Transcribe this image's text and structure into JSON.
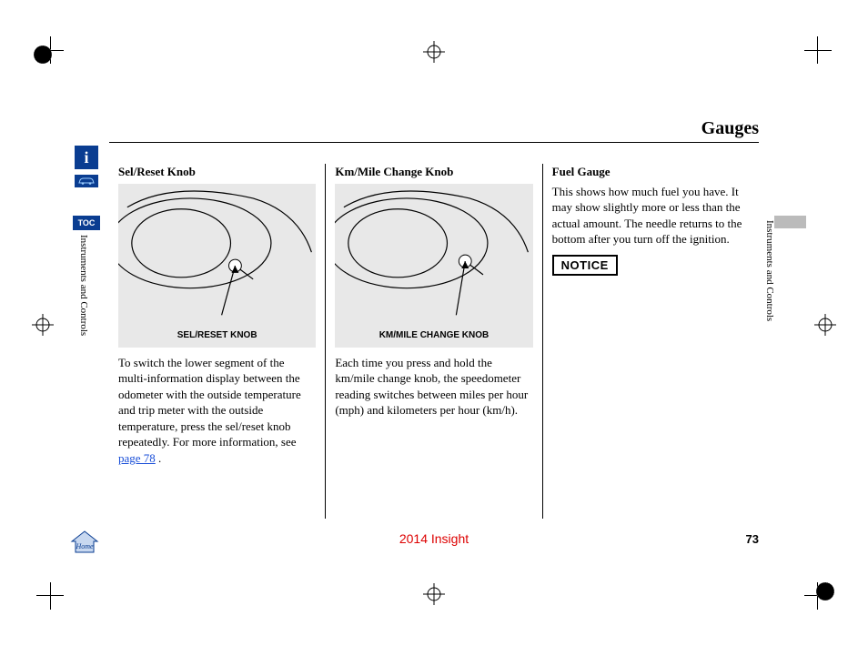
{
  "page_title": "Gauges",
  "section_label_left": "Instruments and Controls",
  "section_label_right": "Instruments and Controls",
  "sidebar": {
    "info_glyph": "i",
    "toc_label": "TOC",
    "home_label": "Home"
  },
  "columns": [
    {
      "heading": "Sel/Reset Knob",
      "figure_caption": "SEL/RESET KNOB",
      "body_before_link": "To switch the lower segment of the multi-information display between the odometer with the outside temperature and trip meter with the outside temperature, press the sel/reset knob repeatedly. For more information, see ",
      "link_text": "page  78",
      "body_after_link": "  ."
    },
    {
      "heading": "Km/Mile Change Knob",
      "figure_caption": "KM/MILE CHANGE KNOB",
      "body": "Each time you press and hold the km/mile change knob, the speedometer reading switches between miles per hour (mph) and kilometers per hour (km/h)."
    },
    {
      "heading": "Fuel Gauge",
      "body": "This shows how much fuel you have. It may show slightly more or less than the actual amount. The needle returns to the bottom after you turn off the ignition.",
      "notice_label": "NOTICE"
    }
  ],
  "footer": {
    "model": "2014 Insight",
    "page_number": "73"
  }
}
